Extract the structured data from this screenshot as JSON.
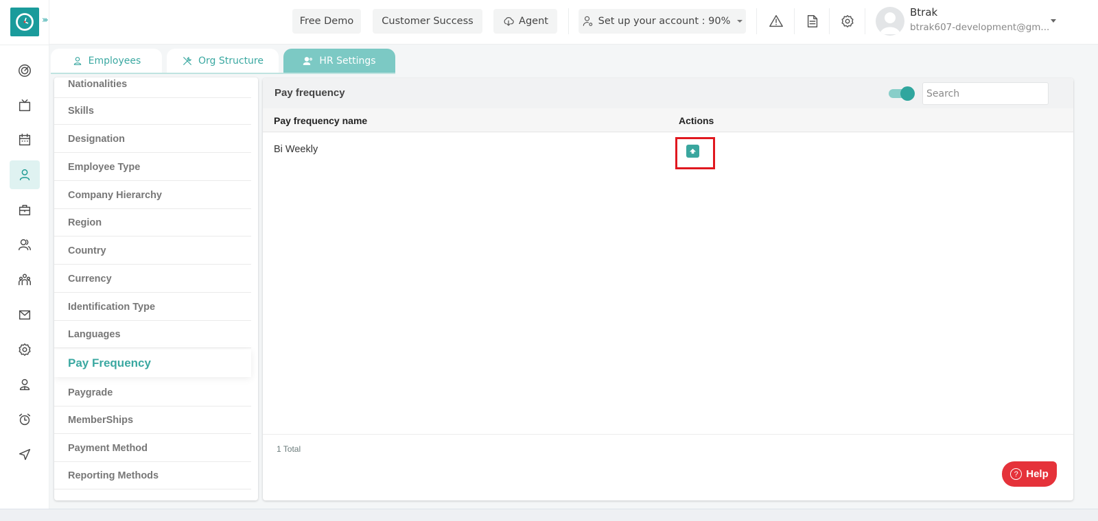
{
  "header": {
    "buttons": {
      "free_demo": "Free Demo",
      "customer_success": "Customer Success",
      "agent": "Agent",
      "setup_account": "Set up your account : 90%"
    },
    "setup_progress_percent": 90,
    "user": {
      "name": "Btrak",
      "email": "btrak607-development@gm..."
    }
  },
  "rail": {
    "items": [
      {
        "icon": "dashboard-icon",
        "active": false
      },
      {
        "icon": "tv-icon",
        "active": false
      },
      {
        "icon": "calendar-icon",
        "active": false
      },
      {
        "icon": "user-icon",
        "active": true
      },
      {
        "icon": "briefcase-icon",
        "active": false
      },
      {
        "icon": "users-icon",
        "active": false
      },
      {
        "icon": "team-icon",
        "active": false
      },
      {
        "icon": "mail-icon",
        "active": false
      },
      {
        "icon": "settings-icon",
        "active": false
      },
      {
        "icon": "profile-icon",
        "active": false
      },
      {
        "icon": "alarm-icon",
        "active": false
      },
      {
        "icon": "send-icon",
        "active": false
      }
    ]
  },
  "tabs": [
    {
      "label": "Employees",
      "active": false
    },
    {
      "label": "Org Structure",
      "active": false
    },
    {
      "label": "HR Settings",
      "active": true
    }
  ],
  "settings_menu": {
    "items": [
      "Nationalities",
      "Skills",
      "Designation",
      "Employee Type",
      "Company Hierarchy",
      "Region",
      "Country",
      "Currency",
      "Identification Type",
      "Languages",
      "Pay Frequency",
      "Paygrade",
      "MemberShips",
      "Payment Method",
      "Reporting Methods"
    ],
    "active": "Pay Frequency"
  },
  "panel": {
    "title": "Pay frequency",
    "archived_toggle_on": true,
    "search_placeholder": "Search",
    "columns": [
      "Pay frequency name",
      "Actions"
    ],
    "rows": [
      {
        "name": "Bi Weekly",
        "action": "restore-archive"
      }
    ],
    "total_label": "1 Total"
  },
  "help": {
    "label": "Help"
  },
  "colors": {
    "brand": "#1a9b9b",
    "accent": "#3aa8a1",
    "highlight": "#e0181f",
    "help": "#e5323a"
  }
}
